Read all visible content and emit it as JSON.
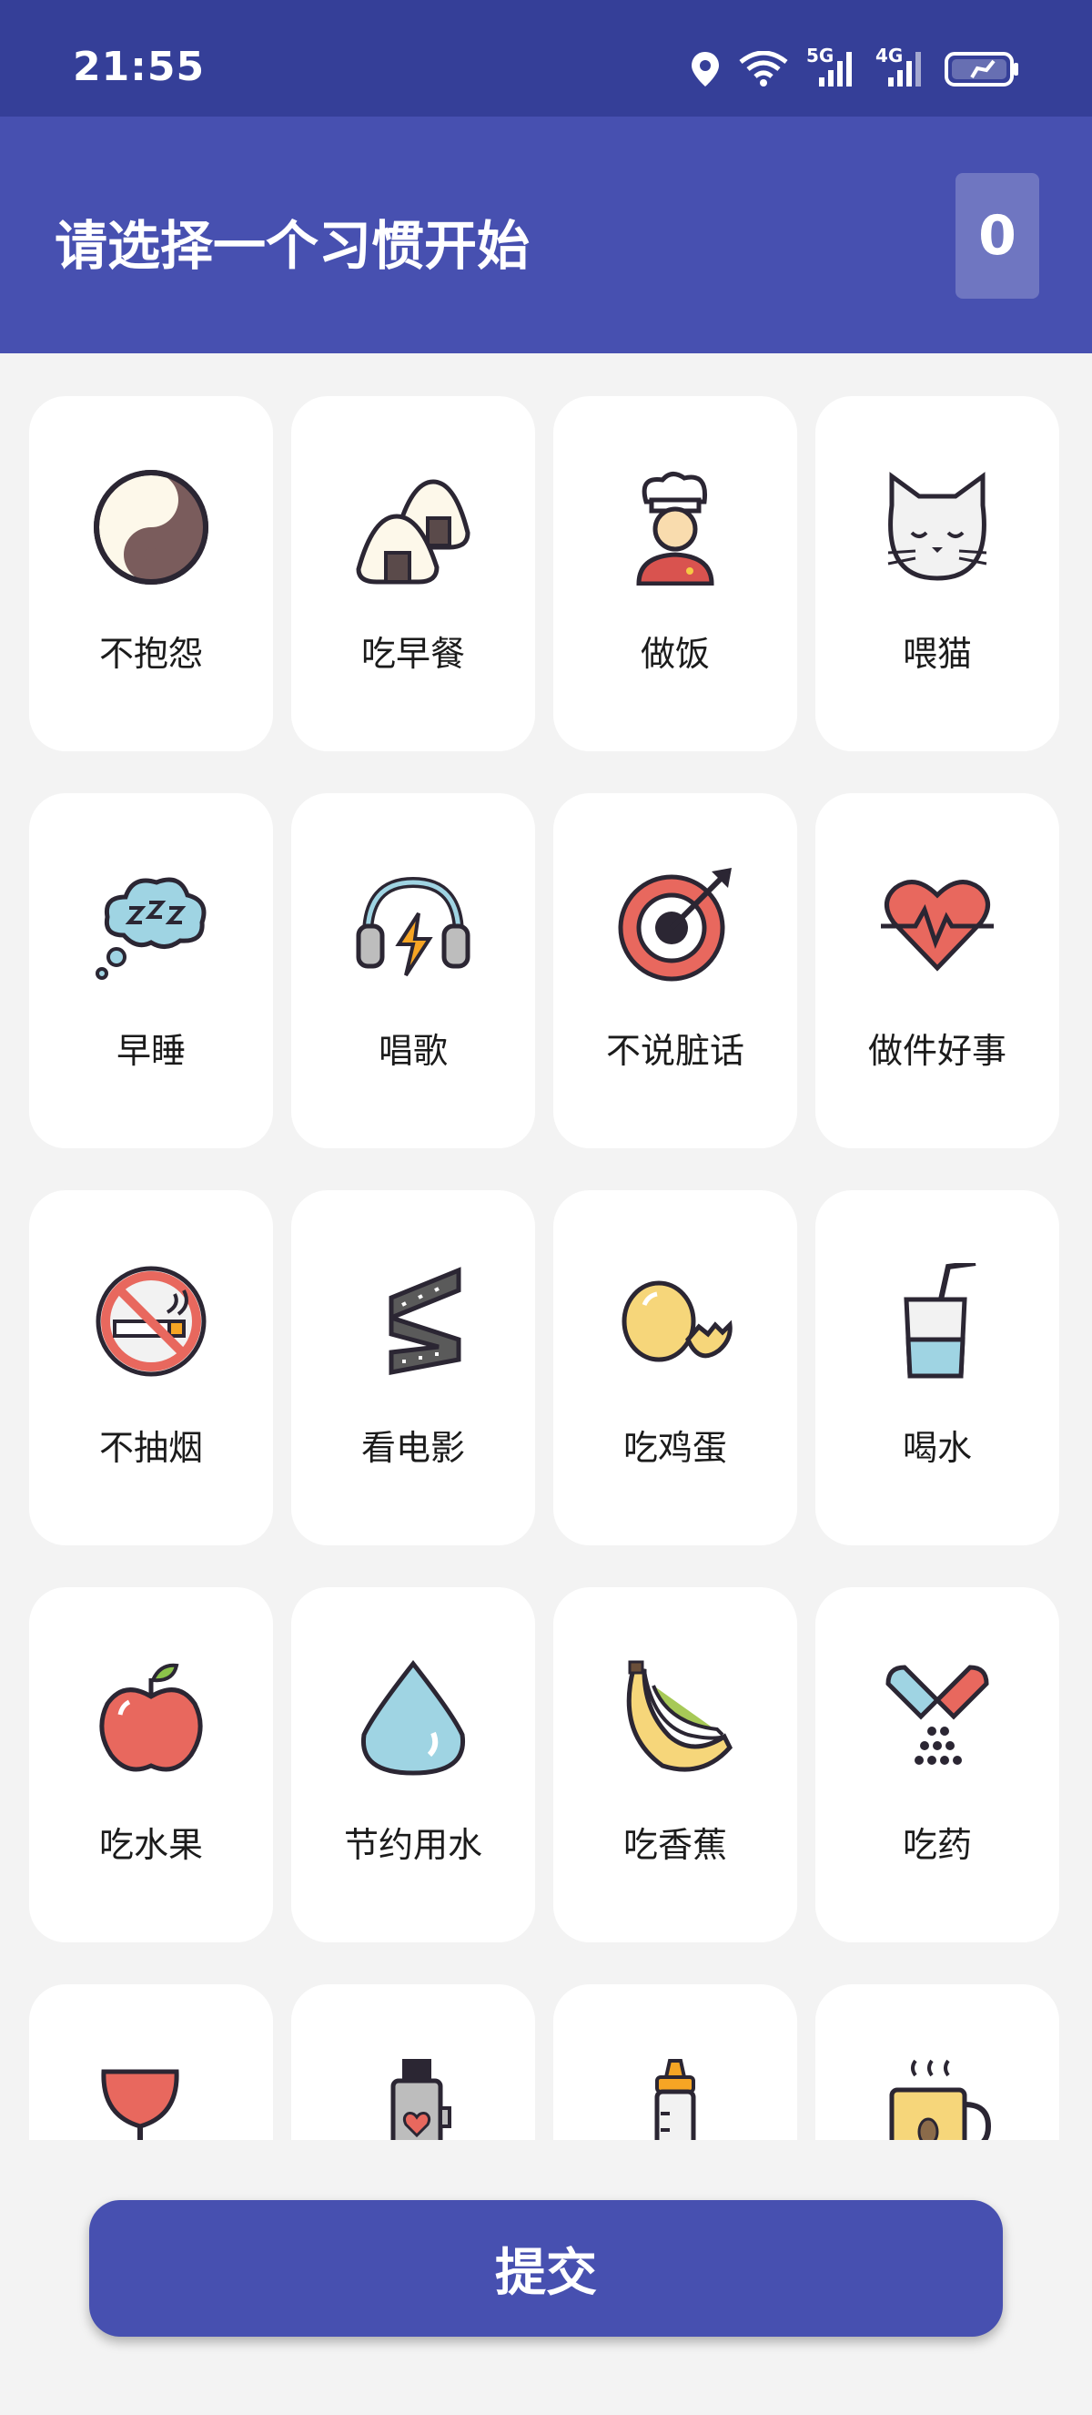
{
  "status_bar": {
    "time": "21:55",
    "net_5g": "5G",
    "net_4g": "4G",
    "icons": [
      "location-icon",
      "wifi-icon",
      "signal-5g-icon",
      "signal-4g-icon",
      "battery-charging-icon"
    ]
  },
  "header": {
    "title": "请选择一个习惯开始",
    "count": "0"
  },
  "habits": [
    {
      "label": "不抱怨",
      "icon": "yin-yang-icon"
    },
    {
      "label": "吃早餐",
      "icon": "rice-ball-icon"
    },
    {
      "label": "做饭",
      "icon": "chef-icon"
    },
    {
      "label": "喂猫",
      "icon": "cat-icon"
    },
    {
      "label": "早睡",
      "icon": "sleep-bubble-icon"
    },
    {
      "label": "唱歌",
      "icon": "headphones-icon"
    },
    {
      "label": "不说脏话",
      "icon": "target-icon"
    },
    {
      "label": "做件好事",
      "icon": "heartbeat-icon"
    },
    {
      "label": "不抽烟",
      "icon": "no-smoking-icon"
    },
    {
      "label": "看电影",
      "icon": "film-strip-icon"
    },
    {
      "label": "吃鸡蛋",
      "icon": "egg-icon"
    },
    {
      "label": "喝水",
      "icon": "water-glass-icon"
    },
    {
      "label": "吃水果",
      "icon": "apple-icon"
    },
    {
      "label": "节约用水",
      "icon": "water-drop-icon"
    },
    {
      "label": "吃香蕉",
      "icon": "banana-icon"
    },
    {
      "label": "吃药",
      "icon": "pills-icon"
    },
    {
      "label": "",
      "icon": "wine-glass-icon"
    },
    {
      "label": "",
      "icon": "usb-heart-icon"
    },
    {
      "label": "",
      "icon": "baby-bottle-icon"
    },
    {
      "label": "",
      "icon": "coffee-mug-icon"
    }
  ],
  "submit_label": "提交",
  "colors": {
    "status_bar": "#353f98",
    "header": "#4750b0",
    "accent": "#4750b0",
    "background": "#f3f3f3",
    "card": "#ffffff"
  }
}
